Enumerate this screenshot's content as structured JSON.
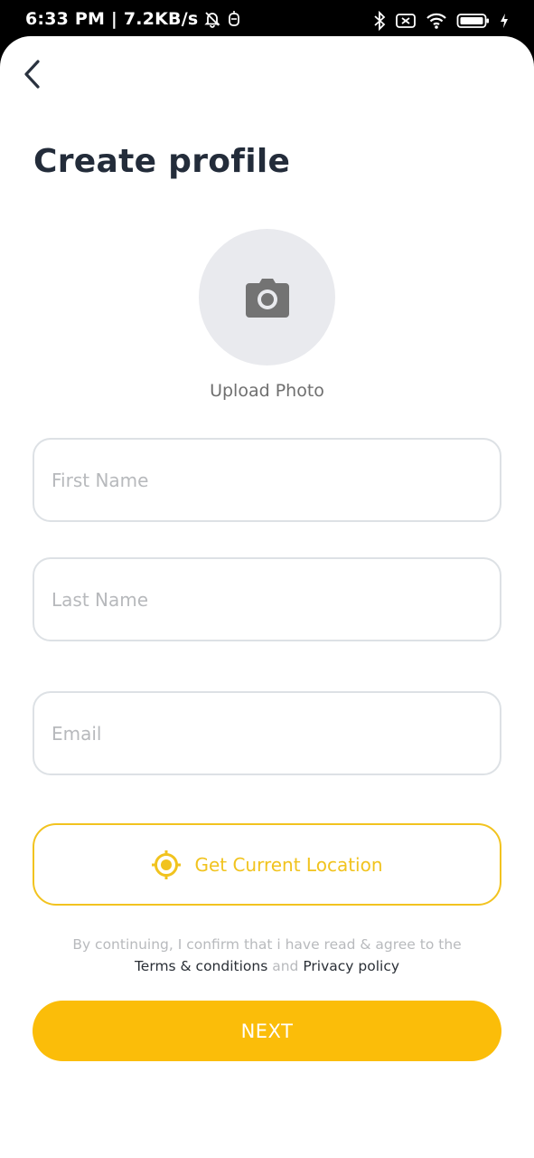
{
  "status_bar": {
    "time_and_speed": "6:33 PM | 7.2KB/s",
    "icons": [
      "muted-bell-icon",
      "sim-icon",
      "bluetooth-icon",
      "battery-x-icon",
      "wifi-icon",
      "battery-icon",
      "charging-bolt-icon"
    ]
  },
  "header": {
    "back_icon": "chevron-left-icon",
    "title": "Create profile"
  },
  "photo": {
    "icon": "camera-icon",
    "label": "Upload Photo"
  },
  "form": {
    "first_name": {
      "placeholder": "First Name",
      "value": ""
    },
    "last_name": {
      "placeholder": "Last Name",
      "value": ""
    },
    "email": {
      "placeholder": "Email",
      "value": ""
    }
  },
  "location": {
    "icon": "crosshair-location-icon",
    "label": "Get Current Location"
  },
  "consent": {
    "line1": "By continuing, I confirm that i have read & agree to the",
    "terms": "Terms & conditions",
    "and": "and",
    "privacy": "Privacy policy"
  },
  "next_label": "NEXT",
  "colors": {
    "accent": "#FBBD09",
    "title": "#232C3A",
    "field_border": "#DDE1E5",
    "placeholder": "#B7B9BC"
  }
}
